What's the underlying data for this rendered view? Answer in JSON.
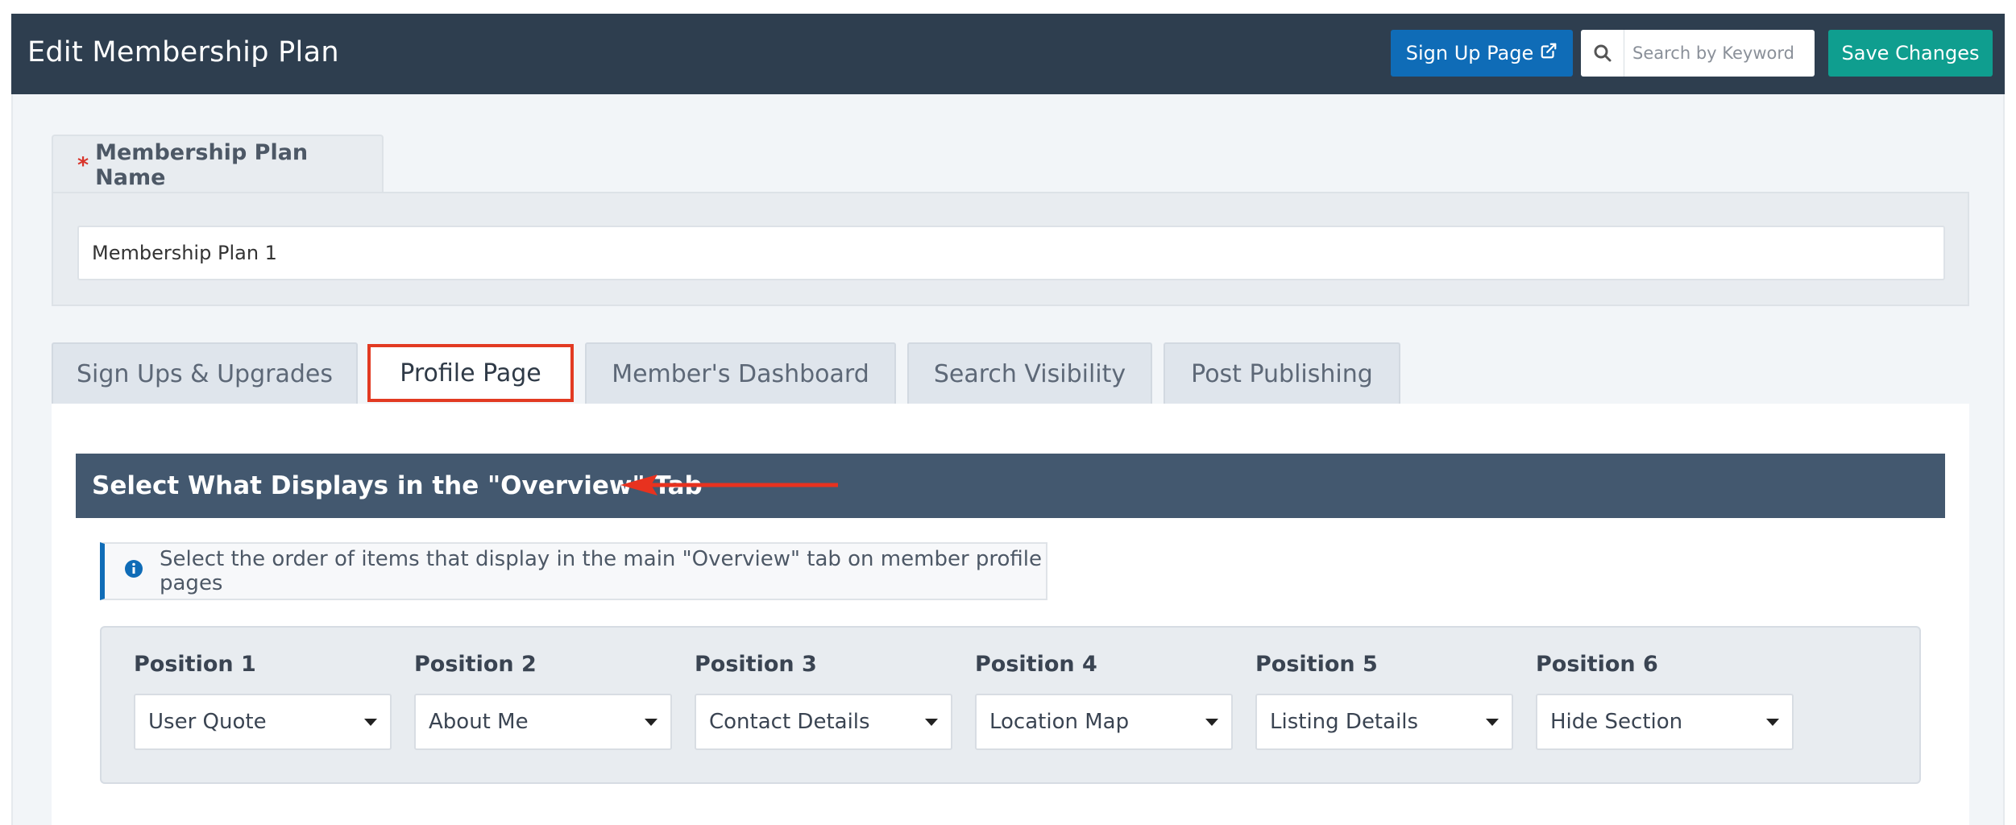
{
  "header": {
    "title": "Edit Membership Plan",
    "signup_button": "Sign Up Page",
    "search_placeholder": "Search by Keyword",
    "save_button": "Save Changes"
  },
  "plan_name": {
    "label": "Membership Plan Name",
    "required_mark": "*",
    "value": "Membership Plan 1"
  },
  "tabs": [
    {
      "label": "Sign Ups & Upgrades",
      "active": false
    },
    {
      "label": "Profile Page",
      "active": true
    },
    {
      "label": "Member's Dashboard",
      "active": false
    },
    {
      "label": "Search Visibility",
      "active": false
    },
    {
      "label": "Post Publishing",
      "active": false
    }
  ],
  "section": {
    "title": "Select What Displays in the \"Overview\" Tab",
    "info_text": "Select the order of items that display in the main \"Overview\" tab on member profile pages"
  },
  "positions": [
    {
      "label": "Position 1",
      "value": "User Quote"
    },
    {
      "label": "Position 2",
      "value": "About Me"
    },
    {
      "label": "Position 3",
      "value": "Contact Details"
    },
    {
      "label": "Position 4",
      "value": "Location Map"
    },
    {
      "label": "Position 5",
      "value": "Listing Details"
    },
    {
      "label": "Position 6",
      "value": "Hide Section"
    }
  ],
  "colors": {
    "header_bg": "#2e3e4f",
    "signup_button": "#0f6cb7",
    "save_button": "#0f9e8f",
    "section_header": "#43586f",
    "highlight": "#e23a22"
  },
  "icons": {
    "external_link": "external-link-icon",
    "search": "search-icon",
    "info": "info-icon",
    "dropdown": "caret-down-icon"
  }
}
